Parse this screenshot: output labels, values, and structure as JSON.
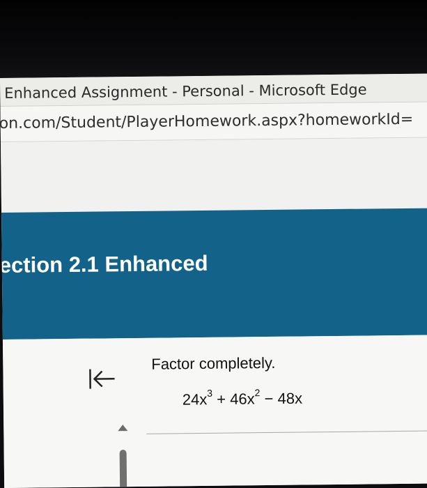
{
  "window": {
    "title": "Enhanced Assignment - Personal - Microsoft Edge"
  },
  "address_bar": {
    "url": "on.com/Student/PlayerHomework.aspx?homeworkId="
  },
  "banner": {
    "title": "ection 2.1 Enhanced",
    "color": "#13628a"
  },
  "navigation": {
    "back_icon": "collapse-left-arrow-icon",
    "scroll_up_icon": "triangle-up-icon"
  },
  "question": {
    "instruction": "Factor completely.",
    "expression": {
      "term1_coef": "24x",
      "term1_exp": "3",
      "op1": " + ",
      "term2_coef": "46x",
      "term2_exp": "2",
      "op2": " − ",
      "term3": "48x"
    }
  }
}
